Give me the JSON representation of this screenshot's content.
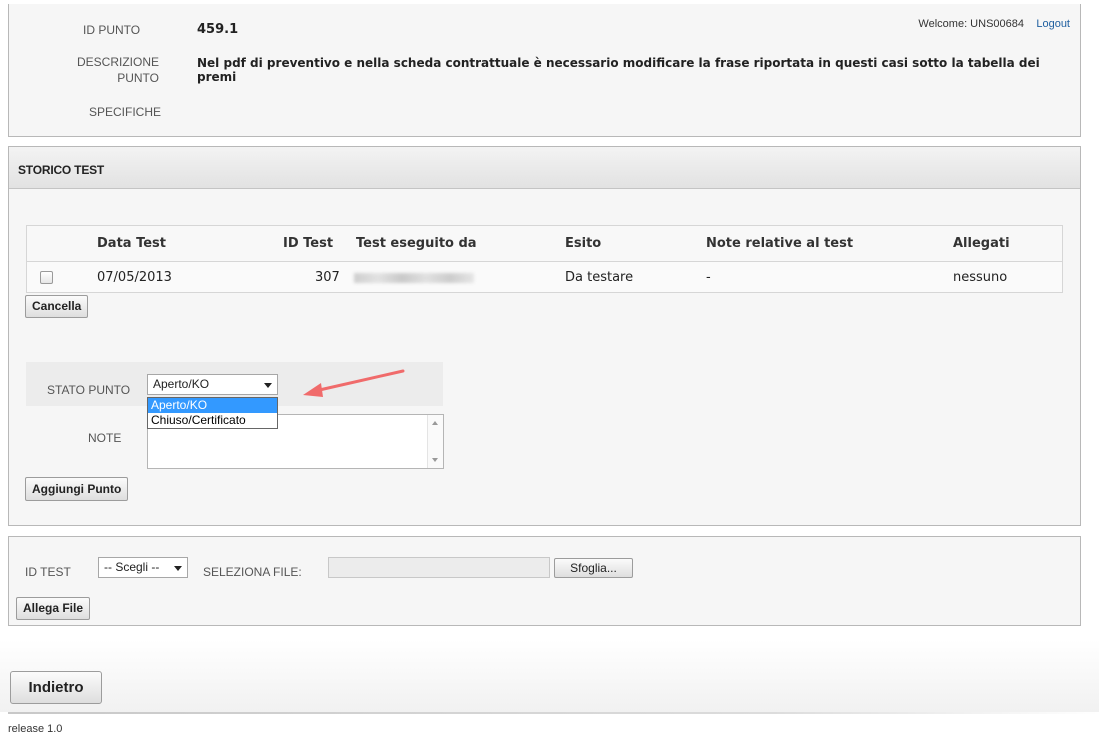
{
  "header": {
    "welcome": "Welcome: UNS00684",
    "logout": "Logout",
    "id_punto_label": "ID PUNTO",
    "id_punto_value": "459.1",
    "descrizione_label_1": "DESCRIZIONE",
    "descrizione_label_2": "PUNTO",
    "descrizione_value_1": "Nel pdf di preventivo e nella scheda contrattuale è necessario modificare la frase riportata in questi casi sotto la tabella dei",
    "descrizione_value_2": "premi",
    "specifiche_label": "SPECIFICHE"
  },
  "storico": {
    "title": "STORICO TEST",
    "columns": [
      "Data Test",
      "ID Test",
      "Test eseguito da",
      "Esito",
      "Note relative al test",
      "Allegati"
    ],
    "rows": [
      {
        "data": "07/05/2013",
        "id": "307",
        "esito": "Da testare",
        "note": "-",
        "allegati": "nessuno"
      }
    ],
    "cancella": "Cancella"
  },
  "form": {
    "stato_label": "STATO PUNTO",
    "stato_selected": "Aperto/KO",
    "stato_options": [
      "Aperto/KO",
      "Chiuso/Certificato"
    ],
    "note_label": "NOTE",
    "aggiungi": "Aggiungi Punto"
  },
  "attach": {
    "id_test_label": "ID TEST",
    "id_test_selected": "-- Scegli --",
    "seleziona_label": "SELEZIONA FILE:",
    "sfoglia": "Sfoglia...",
    "allega": "Allega File"
  },
  "footer": {
    "indietro": "Indietro",
    "release": "release 1.0"
  },
  "colors": {
    "highlight": "#3399ff",
    "arrow": "#f06b6b",
    "link": "#2060a0"
  }
}
